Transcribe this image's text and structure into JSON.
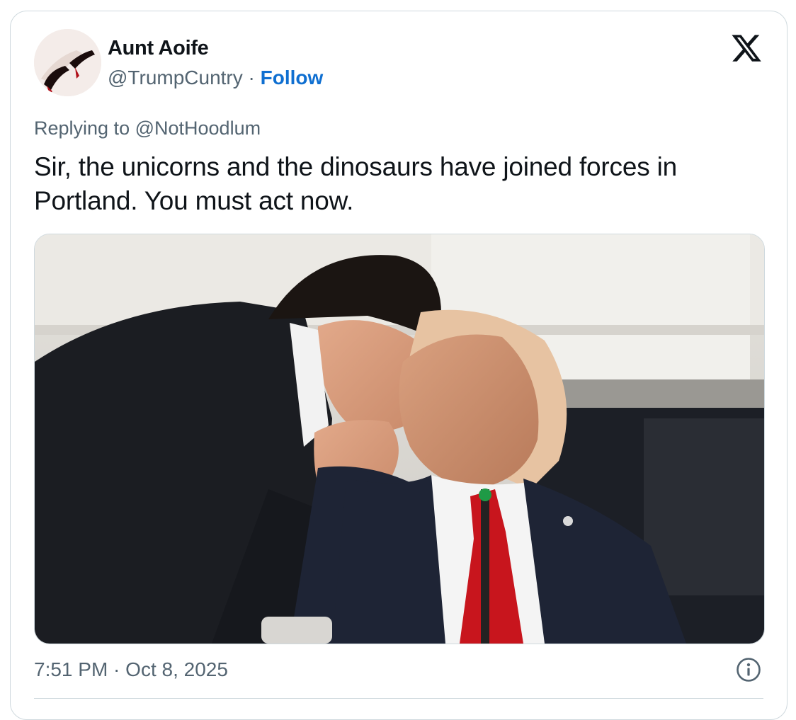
{
  "author": {
    "display_name": "Aunt Aoife",
    "handle": "@TrumpCuntry",
    "separator": " · ",
    "follow_label": "Follow"
  },
  "reply": {
    "prefix": "Replying to ",
    "mention": "@NotHoodlum"
  },
  "tweet": {
    "text": "Sir, the unicorns and the dinosaurs have joined forces in Portland. You must act now."
  },
  "timestamp": "7:51 PM · Oct 8, 2025",
  "icons": {
    "platform": "x-logo-icon",
    "info": "info-icon"
  },
  "colors": {
    "follow_link": "#0f6fd1",
    "secondary_text": "#536471",
    "border": "#cfd9de"
  }
}
